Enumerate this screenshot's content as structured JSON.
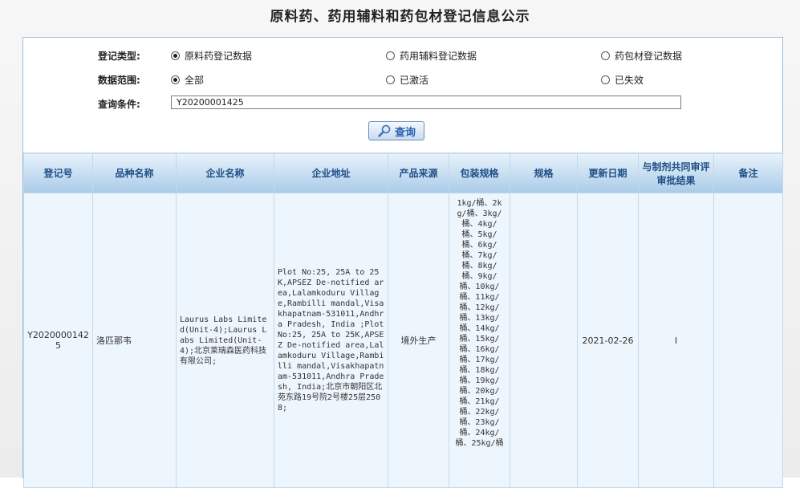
{
  "page": {
    "title": "原料药、药用辅料和药包材登记信息公示"
  },
  "form": {
    "type_label": "登记类型:",
    "type_options": [
      "原料药登记数据",
      "药用辅料登记数据",
      "药包材登记数据"
    ],
    "scope_label": "数据范围:",
    "scope_options": [
      "全部",
      "已激活",
      "已失效"
    ],
    "query_label": "查询条件:",
    "query_value": "Y20200001425",
    "search_button": "查询"
  },
  "table": {
    "headers": [
      "登记号",
      "品种名称",
      "企业名称",
      "企业地址",
      "产品来源",
      "包装规格",
      "规格",
      "更新日期",
      "与制剂共同审评审批结果",
      "备注"
    ],
    "row": {
      "reg_no": "Y20200001425",
      "variety": "洛匹那韦",
      "company": "Laurus Labs Limited(Unit-4);Laurus Labs Limited(Unit-4);北京莱瑞森医药科技有限公司;",
      "address": "Plot No:25, 25A to 25K,APSEZ De-notified area,Lalamkoduru Village,Rambilli mandal,Visakhapatnam-531011,Andhra Pradesh, India ;Plot No:25, 25A to 25K,APSEZ De-notified area,Lalamkoduru Village,Rambilli mandal,Visakhapatnam-531011,Andhra Pradesh, India;北京市朝阳区北苑东路19号院2号楼25层2508;",
      "source": "境外生产",
      "package": "1kg/桶、2kg/桶、3kg/桶、4kg/桶、5kg/桶、6kg/桶、7kg/桶、8kg/桶、9kg/桶、10kg/桶、11kg/桶、12kg/桶、13kg/桶、14kg/桶、15kg/桶、16kg/桶、17kg/桶、18kg/桶、19kg/桶、20kg/桶、21kg/桶、22kg/桶、23kg/桶、24kg/桶、25kg/桶",
      "spec": "",
      "updated": "2021-02-26",
      "review_result": "I",
      "remark": ""
    }
  }
}
